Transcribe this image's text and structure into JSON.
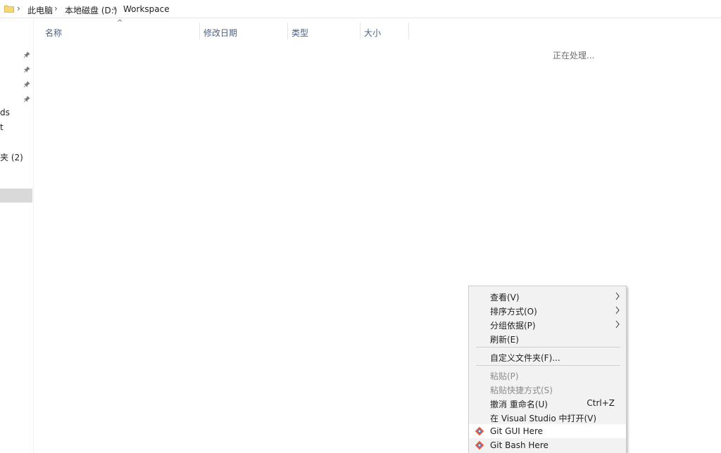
{
  "breadcrumb": {
    "items": [
      "此电脑",
      "本地磁盘 (D:)",
      "Workspace"
    ]
  },
  "nav_pane": {
    "items": [
      "ds",
      "t",
      "夹 (2)"
    ]
  },
  "columns": {
    "name": "名称",
    "modified": "修改日期",
    "type": "类型",
    "size": "大小"
  },
  "status": {
    "processing": "正在处理..."
  },
  "context_menu": {
    "items": [
      {
        "label": "查看(V)",
        "submenu": true,
        "enabled": true
      },
      {
        "label": "排序方式(O)",
        "submenu": true,
        "enabled": true
      },
      {
        "label": "分组依据(P)",
        "submenu": true,
        "enabled": true
      },
      {
        "label": "刷新(E)",
        "enabled": true
      },
      {
        "label": "自定义文件夹(F)...",
        "enabled": true
      },
      {
        "label": "粘贴(P)",
        "enabled": false
      },
      {
        "label": "粘贴快捷方式(S)",
        "enabled": false
      },
      {
        "label": "撤消 重命名(U)",
        "shortcut": "Ctrl+Z",
        "enabled": true
      },
      {
        "label": "在 Visual Studio 中打开(V)",
        "enabled": true
      },
      {
        "label": "Git GUI Here",
        "icon": "git-icon",
        "enabled": true
      },
      {
        "label": "Git Bash Here",
        "icon": "git-icon",
        "enabled": true
      }
    ]
  },
  "colors": {
    "column_header_text": "#4d6082",
    "folder_yellow": "#f8d775",
    "git_orange": "#f05133",
    "menu_background": "#f2f2f2"
  }
}
